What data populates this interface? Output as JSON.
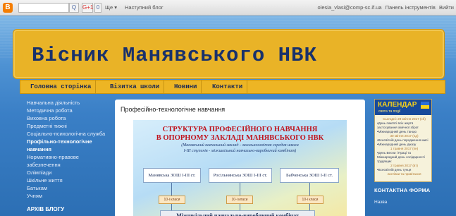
{
  "navbar": {
    "logo": "B",
    "search_button": "Q",
    "google_button": "G+1",
    "more_button": "0",
    "share": "Ще ▾",
    "next_blog": "Наступний блог",
    "user_email": "olesia_vlasi@comp-sc.if.ua",
    "dashboard": "Панель інструментів",
    "exit": "Вийти"
  },
  "blog": {
    "title": "Вісник Манявського НВК"
  },
  "tabs": [
    "Головна сторінка",
    "Візитка школи",
    "Новини",
    "Контакти"
  ],
  "left_nav": [
    "Навчальна діяльність",
    "Методична робота",
    "Виховна робота",
    "Предметні тижні",
    "Соціально-психологічна служба",
    "Профільно-технологічне навчання",
    "Нормативно-правове забезпечення",
    "Олімпіади",
    "Шкільне життя",
    "Батькам",
    "Учням"
  ],
  "archive_title": "АРХІВ БЛОГУ",
  "post": {
    "title": "Професійно-технологічне навчання",
    "scheme": {
      "line1": "СТРУКТУРА ПРОФЕСІЙНОГО НАВЧАННЯ",
      "line2": "В ОПОРНОМУ ЗАКЛАДІ МАНЯВСЬКОГО НВК",
      "sub1": "(Манявський навчальний заклад - загальноосвітня середня школа",
      "sub2": "І-ІІІ ступенів - міжшкільний навчально-виробничий комбінат)",
      "schools": [
        "Манявська ЗОШ І-ІІІ ст.",
        "Росільнянська ЗОШ І-ІІІ ст.",
        "Бабченська ЗОШ І-ІІ ст."
      ],
      "classes": [
        "10-і класи",
        "10-і класи",
        "10-і класи"
      ],
      "bottom": "Міжшкільний навчально-виробничий комбінат"
    }
  },
  "calendar": {
    "title": "КАЛЕНДАР",
    "subtitle": "свята та події",
    "items": [
      {
        "text": "Сьогодні: 29 квітня 2017 (сб)",
        "date": true
      },
      {
        "text": "•День пам'яті всіх жертв застосування хімічної зброї",
        "date": false
      },
      {
        "text": "•Міжнародний день танцю",
        "date": false
      },
      {
        "text": "30 квітня 2017 (нд)",
        "date": true
      },
      {
        "text": "•Всесвітній день породження мисі",
        "date": false
      },
      {
        "text": "•Міжнародний день джазу",
        "date": false
      },
      {
        "text": "1 травня 2017 (пн)",
        "date": true
      },
      {
        "text": "•День Весни і Праці та Міжнародний день солідарності трудящих",
        "date": false
      },
      {
        "text": "2 травня 2017 (вт)",
        "date": true
      },
      {
        "text": "•Всесвітній день тунця",
        "date": false
      },
      {
        "text": "листівки та привітання",
        "date": true
      }
    ]
  },
  "contact_form": {
    "title": "КОНТАКТНА ФОРМА",
    "name_label": "Назва"
  },
  "colors": {
    "header_bg": "#e9b327",
    "header_text": "#19316b",
    "page_bg": "#2c6fb4",
    "calendar_head": "#174a9b"
  }
}
